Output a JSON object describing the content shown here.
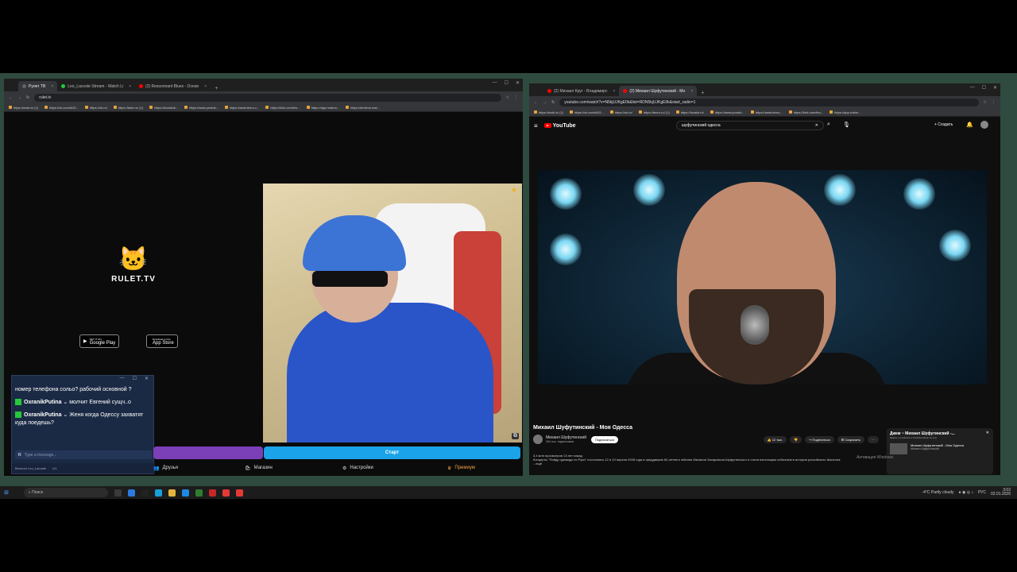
{
  "left_window": {
    "tabs": [
      {
        "label": "Рулет ТВ",
        "color": "#5f6368",
        "active": true
      },
      {
        "label": "Leo_Lacoste Stream - Watch Li",
        "color": "#25c93b",
        "active": false
      },
      {
        "label": "(2) Ressonnant Blues - Ocean",
        "color": "#ff0000",
        "active": false
      }
    ],
    "url": "rulet.tv",
    "bookmarks": [
      "https://mail.ru/ (1)",
      "https://vk.com/id19...",
      "https://ok.ru/",
      "https://tank.ru/ (1)",
      "https://koolclub...",
      "https://www.youtub...",
      "https://www.tenru.c...",
      "https://kick.com/leo...",
      "https://app.rostron...",
      "https://dtortrou.mal..."
    ],
    "site": {
      "logo_text": "RULET.TV",
      "google_play": "Google Play",
      "google_play_small": "GET IT ON",
      "app_store": "App Store",
      "app_store_small": "Download on the"
    },
    "chat": {
      "messages": [
        {
          "user": "",
          "text": "номер телефона сольо? рабочий основной ?"
        },
        {
          "user": "OxranikPutina",
          "text": "молчит Евгений сущч..о"
        },
        {
          "user": "OxranikPutina",
          "text": "Женя когда Одессу захватят куда поедешь?"
        }
      ],
      "input_placeholder": "Type a message...",
      "footer_user": "Benomn Leo_Lacoste",
      "footer_count": "1/1"
    },
    "start_button": "Старт",
    "nav": [
      {
        "label": "Друзья",
        "color": "#ddd"
      },
      {
        "label": "Магазин",
        "color": "#ddd"
      },
      {
        "label": "Настройки",
        "color": "#ddd"
      },
      {
        "label": "Премиум",
        "color": "#f0a040"
      }
    ]
  },
  "right_window": {
    "tabs": [
      {
        "label": "(2) Михаил Круг - Владимирс",
        "color": "#ff0000",
        "active": false
      },
      {
        "label": "(2) Михаил Шуфутинский - Мо",
        "color": "#ff0000",
        "active": true
      }
    ],
    "url": "youtube.com/watch?v=N5kjUJKgE0k&list=RDN5kjUJKgE0k&start_radio=1",
    "bookmarks": [
      "https://mail.ru/ (1)",
      "https://vk.com/id19...",
      "https://ok.ru/",
      "https://tenru.ru/ (1)",
      "https://localzt.ru/",
      "https://www.youtub...",
      "https://www.tenru...",
      "https://kick.com/leo...",
      "https://app.rostro..."
    ],
    "youtube": {
      "logo": "YouTube",
      "search_query": "шуфутинский одесса",
      "create": "+ Создать",
      "video_title": "Михаил Шуфутинский - Моя Одесса",
      "channel": "Михаил Шуфутинский",
      "subscribers": "264 тыс. подписчиков",
      "subscribe": "Подписаться",
      "likes": "12 тыс.",
      "share": "Поделиться",
      "save": "Сохранить",
      "views_date": "3,4 млн просмотров  13 лет назад",
      "description": "Концерты \"Пойду однажды по Руси\" состоялись 12 и 13 апреля 2008 года в преддверии 60-летнего юбилея Михаила Захаровича Шуфутинского и стали настоящим событием в истории российского Шансона.",
      "description_more": "...ещё",
      "mix_title": "Джем ~ Михаил Шуфутинский -...",
      "mix_sub": "Миксы и плейлисты YouTube Music for you",
      "mix_item": "Михаил Шуфутинский - Моя Одесса",
      "mix_item_channel": "Михаил Шуфутинский",
      "watermark": "Активация Windows"
    }
  },
  "taskbar": {
    "search": "Поиск",
    "weather": "-4°C  Partly cloudy",
    "lang": "РУС",
    "time": "3:03",
    "date": "02.01.2026"
  }
}
